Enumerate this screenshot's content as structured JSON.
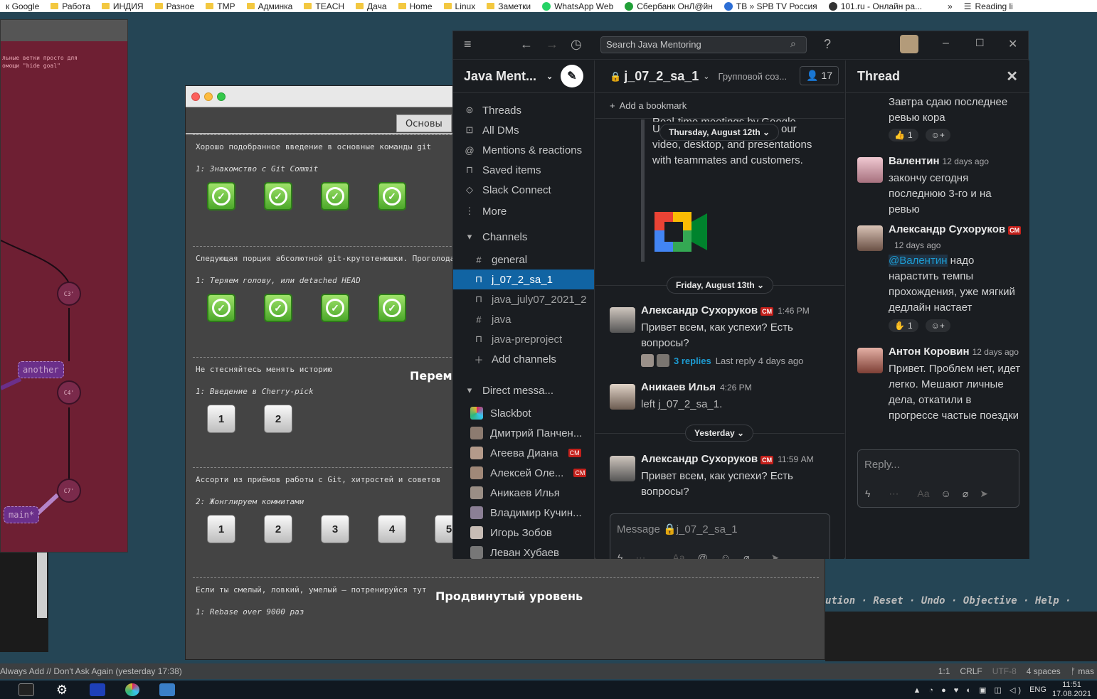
{
  "bookmarks": [
    {
      "label": "к Google",
      "icon": "google-icon"
    },
    {
      "label": "Работа",
      "icon": "folder-icon"
    },
    {
      "label": "ИНДИЯ",
      "icon": "folder-icon"
    },
    {
      "label": "Разное",
      "icon": "folder-icon"
    },
    {
      "label": "TMP",
      "icon": "folder-icon"
    },
    {
      "label": "Админка",
      "icon": "folder-icon"
    },
    {
      "label": "TEACH",
      "icon": "folder-icon"
    },
    {
      "label": "Дача",
      "icon": "folder-icon"
    },
    {
      "label": "Home",
      "icon": "folder-icon"
    },
    {
      "label": "Linux",
      "icon": "folder-icon"
    },
    {
      "label": "Заметки",
      "icon": "folder-icon"
    },
    {
      "label": "WhatsApp Web",
      "icon": "whatsapp-icon"
    },
    {
      "label": "Сбербанк ОнЛ@йн",
      "icon": "sberbank-icon"
    },
    {
      "label": "ТВ » SPB TV Россия",
      "icon": "tv-icon"
    },
    {
      "label": "101.ru - Онлайн ра...",
      "icon": "radio-icon"
    }
  ],
  "bookmarks_more": "»",
  "reading_list": "Reading li",
  "git_window": {
    "note": "льные ветки просто для\nомощи \"hide goal\"",
    "nodes": [
      "C3'",
      "C4'",
      "C7'"
    ],
    "tags": [
      "another",
      "main*"
    ]
  },
  "learn_git": {
    "tab": "Основы",
    "levels": [
      {
        "desc": "Хорошо подобранное введение в основные команды git",
        "sub": "1: Знакомство с Git Commit",
        "buttons": [
          "✓",
          "✓",
          "✓",
          "✓"
        ],
        "done": true
      },
      {
        "desc": "Следующая порция абсолютной git-крутотенюшки. Проголода",
        "sub": "1: Теряем голову, или detached HEAD",
        "buttons": [
          "✓",
          "✓",
          "✓",
          "✓"
        ],
        "done": true
      },
      {
        "desc": "Не стесняйтесь менять историю",
        "sub": "1: Введение в Cherry-pick",
        "buttons": [
          "1",
          "2"
        ],
        "done": false
      },
      {
        "desc": "Ассорти из приёмов работы с Git, хитростей и советов",
        "sub": "2: Жонглируем коммитами",
        "buttons": [
          "1",
          "2",
          "3",
          "4",
          "5"
        ],
        "done": false
      },
      {
        "desc": "Если ты смелый, ловкий, умелый – потренируйся тут",
        "sub": "1: Rebase over 9000 раз",
        "buttons": [],
        "done": false
      }
    ],
    "section_peremeshenie": "Переме",
    "section_advanced": "Продвинутый уровень",
    "bottom_links": "ution · Reset · Undo · Objective · Help ·"
  },
  "slack": {
    "search_placeholder": "Search Java Mentoring",
    "workspace": "Java Ment...",
    "nav": [
      {
        "label": "Threads",
        "icon": "threads-icon"
      },
      {
        "label": "All DMs",
        "icon": "dms-icon"
      },
      {
        "label": "Mentions & reactions",
        "icon": "at-icon"
      },
      {
        "label": "Saved items",
        "icon": "bookmark-icon"
      },
      {
        "label": "Slack Connect",
        "icon": "connect-icon"
      },
      {
        "label": "More",
        "icon": "more-icon"
      }
    ],
    "channels_header": "Channels",
    "channels": [
      {
        "label": "general",
        "icon": "#",
        "active": false
      },
      {
        "label": "j_07_2_sa_1",
        "icon": "🔒",
        "active": true
      },
      {
        "label": "java_july07_2021_2",
        "icon": "🔒",
        "active": false
      },
      {
        "label": "java",
        "icon": "#",
        "active": false
      },
      {
        "label": "java-preproject",
        "icon": "🔒",
        "active": false
      }
    ],
    "add_channels": "Add channels",
    "dm_header": "Direct messa...",
    "dms": [
      {
        "label": "Slackbot",
        "badge": ""
      },
      {
        "label": "Дмитрий Панчен...",
        "badge": ""
      },
      {
        "label": "Агеева Диана",
        "badge": "CM"
      },
      {
        "label": "Алексей Оле...",
        "badge": "CM"
      },
      {
        "label": "Аникаев Илья",
        "badge": ""
      },
      {
        "label": "Владимир Кучин...",
        "badge": ""
      },
      {
        "label": "Игорь Зобов",
        "badge": ""
      },
      {
        "label": "Леван Хубаев",
        "badge": ""
      }
    ],
    "channel": {
      "name": "j_07_2_sa_1",
      "topic": "Групповой соз...",
      "members": "17",
      "add_bookmark": "Add a bookmark",
      "meet_text_1": "Real-time meetings by Google.",
      "meet_text_2": "U",
      "meet_text_3": "our",
      "meet_text_4": "video, desktop, and presentations",
      "meet_text_5": "with teammates and customers.",
      "date1": "Thursday, August 12th",
      "date2": "Friday, August 13th",
      "date3": "Yesterday",
      "messages": [
        {
          "name": "Александр Сухоруков",
          "badge": "CM",
          "time": "1:46 PM",
          "text": "Привет всем, как успехи? Есть вопросы?",
          "replies": "3 replies",
          "last_reply": "Last reply 4 days ago"
        },
        {
          "name": "Аникаев Илья",
          "badge": "",
          "time": "4:26 PM",
          "text": "left j_07_2_sa_1."
        },
        {
          "name": "Александр Сухоруков",
          "badge": "CM",
          "time": "11:59 AM",
          "text": "Привет всем, как успехи? Есть вопросы?"
        }
      ],
      "composer_placeholder": "Message 🔒j_07_2_sa_1"
    },
    "thread": {
      "title": "Thread",
      "top_text": "Завтра сдаю последнее ревью кора",
      "top_reaction": {
        "emoji": "👍",
        "count": "1"
      },
      "messages": [
        {
          "name": "Валентин",
          "badge": "",
          "time": "12 days ago",
          "text": "закончу сегодня последнюю 3-го и на ревью"
        },
        {
          "name": "Александр Сухоруков",
          "badge": "CM",
          "time": "12 days ago",
          "mention": "@Валентин",
          "text": " надо нарастить темпы прохождения, уже мягкий дедлайн настает",
          "reaction": {
            "emoji": "✋",
            "count": "1"
          }
        },
        {
          "name": "Антон Коровин",
          "badge": "",
          "time": "12 days ago",
          "text": "Привет. Проблем нет, идет легко. Мешают личные дела, откатили в прогрессе частые поездки"
        }
      ],
      "reply_placeholder": "Reply..."
    }
  },
  "statusbar": {
    "left": "Always Add // Don't Ask Again (yesterday 17:38)",
    "pos": "1:1",
    "eol": "CRLF",
    "enc": "UTF-8",
    "indent": "4 spaces",
    "branch": "mas"
  },
  "taskbar": {
    "lang": "ENG",
    "time": "11:51",
    "date": "17.08.2021"
  },
  "colors": {
    "slack_active": "#1164a3",
    "level_done": "#4ca82a"
  }
}
